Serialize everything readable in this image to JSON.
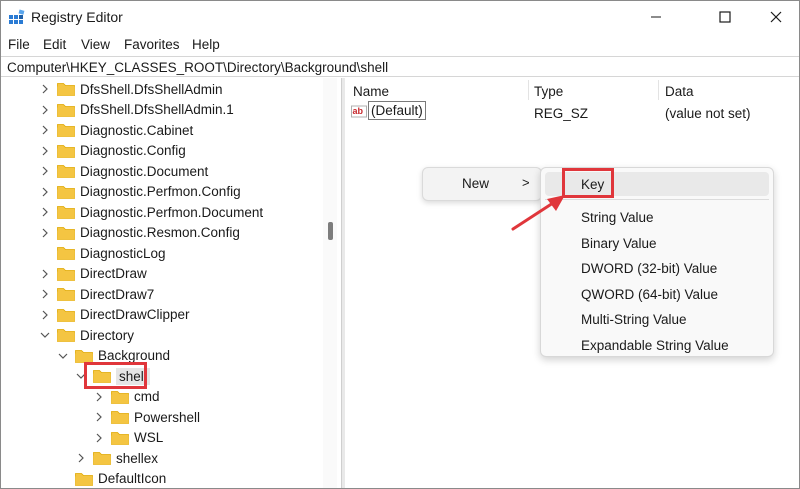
{
  "window": {
    "title": "Registry Editor",
    "controls": [
      "minimize",
      "maximize",
      "close"
    ]
  },
  "menubar": [
    "File",
    "Edit",
    "View",
    "Favorites",
    "Help"
  ],
  "address": "Computer\\HKEY_CLASSES_ROOT\\Directory\\Background\\shell",
  "tree": [
    {
      "label": "DfsShell.DfsShellAdmin",
      "chevron": "right",
      "level": 0
    },
    {
      "label": "DfsShell.DfsShellAdmin.1",
      "chevron": "right",
      "level": 0
    },
    {
      "label": "Diagnostic.Cabinet",
      "chevron": "right",
      "level": 0
    },
    {
      "label": "Diagnostic.Config",
      "chevron": "right",
      "level": 0
    },
    {
      "label": "Diagnostic.Document",
      "chevron": "right",
      "level": 0
    },
    {
      "label": "Diagnostic.Perfmon.Config",
      "chevron": "right",
      "level": 0
    },
    {
      "label": "Diagnostic.Perfmon.Document",
      "chevron": "right",
      "level": 0
    },
    {
      "label": "Diagnostic.Resmon.Config",
      "chevron": "right",
      "level": 0
    },
    {
      "label": "DiagnosticLog",
      "chevron": "none",
      "level": 0
    },
    {
      "label": "DirectDraw",
      "chevron": "right",
      "level": 0
    },
    {
      "label": "DirectDraw7",
      "chevron": "right",
      "level": 0
    },
    {
      "label": "DirectDrawClipper",
      "chevron": "right",
      "level": 0
    },
    {
      "label": "Directory",
      "chevron": "down",
      "level": 0
    },
    {
      "label": "Background",
      "chevron": "down",
      "level": 1
    },
    {
      "label": "shell",
      "chevron": "down",
      "level": 2,
      "selected": true
    },
    {
      "label": "cmd",
      "chevron": "right",
      "level": 3
    },
    {
      "label": "Powershell",
      "chevron": "right",
      "level": 3
    },
    {
      "label": "WSL",
      "chevron": "right",
      "level": 3
    },
    {
      "label": "shellex",
      "chevron": "right",
      "level": 2
    },
    {
      "label": "DefaultIcon",
      "chevron": "none",
      "level": 1
    }
  ],
  "list": {
    "headers": {
      "name": "Name",
      "type": "Type",
      "data": "Data"
    },
    "rows": [
      {
        "icon": "ab",
        "name": "(Default)",
        "type": "REG_SZ",
        "data": "(value not set)"
      }
    ]
  },
  "context_menu": {
    "new_label": "New",
    "new_chevron": ">",
    "items": [
      "Key",
      "String Value",
      "Binary Value",
      "DWORD (32-bit) Value",
      "QWORD (64-bit) Value",
      "Multi-String Value",
      "Expandable String Value"
    ]
  },
  "colors": {
    "highlight": "#e0363b",
    "folder": "#f4c542",
    "folder_dark": "#e0a800"
  }
}
